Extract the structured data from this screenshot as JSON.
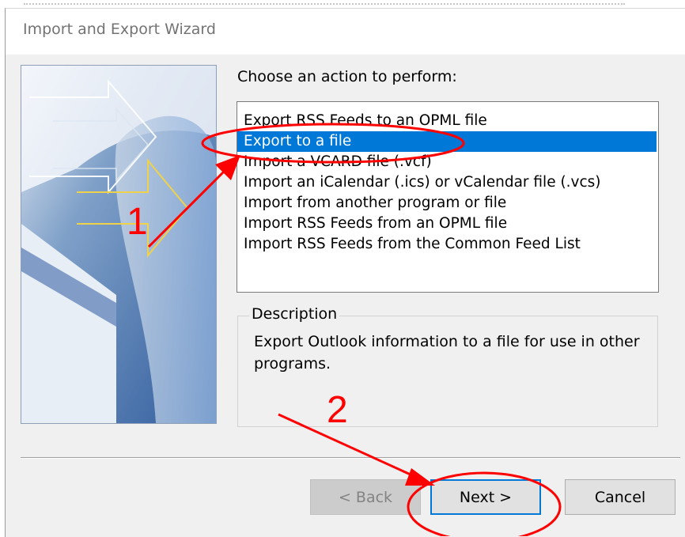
{
  "dialog": {
    "title": "Import and Export Wizard"
  },
  "main": {
    "prompt": "Choose an action to perform:",
    "options": [
      {
        "label": "Export RSS Feeds to an OPML file",
        "selected": false
      },
      {
        "label": "Export to a file",
        "selected": true
      },
      {
        "label": "Import a VCARD file (.vcf)",
        "selected": false
      },
      {
        "label": "Import an iCalendar (.ics) or vCalendar file (.vcs)",
        "selected": false
      },
      {
        "label": "Import from another program or file",
        "selected": false
      },
      {
        "label": "Import RSS Feeds from an OPML file",
        "selected": false
      },
      {
        "label": "Import RSS Feeds from the Common Feed List",
        "selected": false
      }
    ],
    "description": {
      "legend": "Description",
      "text": "Export Outlook information to a file for use in other programs."
    }
  },
  "buttons": {
    "back": "< Back",
    "next": "Next >",
    "cancel": "Cancel"
  },
  "annotations": {
    "step1": "1",
    "step2": "2",
    "color": "#ff0000"
  },
  "colors": {
    "selection": "#0078d7",
    "dialog_bg": "#f0f0f0"
  }
}
